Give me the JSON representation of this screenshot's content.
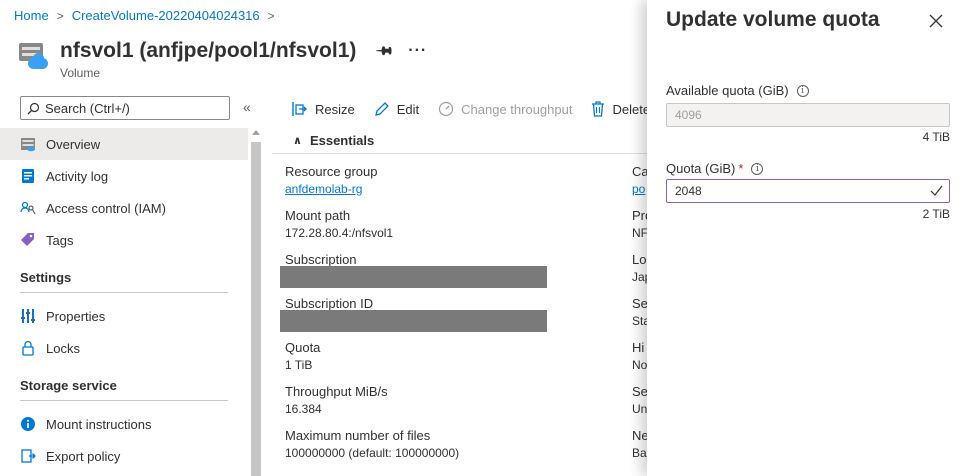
{
  "breadcrumb": {
    "items": [
      "Home",
      "CreateVolume-20220404024316"
    ]
  },
  "header": {
    "title": "nfsvol1 (anfjpe/pool1/nfsvol1)",
    "subtitle": "Volume"
  },
  "sidebar": {
    "search_placeholder": "Search (Ctrl+/)",
    "items": [
      {
        "label": "Overview",
        "icon": "overview-icon",
        "active": true
      },
      {
        "label": "Activity log",
        "icon": "activity-log-icon"
      },
      {
        "label": "Access control (IAM)",
        "icon": "iam-icon"
      },
      {
        "label": "Tags",
        "icon": "tag-icon"
      }
    ],
    "sections": [
      {
        "title": "Settings",
        "items": [
          {
            "label": "Properties",
            "icon": "properties-icon"
          },
          {
            "label": "Locks",
            "icon": "lock-icon"
          }
        ]
      },
      {
        "title": "Storage service",
        "items": [
          {
            "label": "Mount instructions",
            "icon": "info-icon"
          },
          {
            "label": "Export policy",
            "icon": "export-policy-icon"
          }
        ]
      }
    ]
  },
  "toolbar": {
    "resize": "Resize",
    "edit": "Edit",
    "change_throughput": "Change throughput",
    "delete": "Delete"
  },
  "essentials": {
    "heading": "Essentials",
    "left": [
      {
        "label": "Resource group",
        "value": "anfdemolab-rg",
        "link": true
      },
      {
        "label": "Mount path",
        "value": "172.28.80.4:/nfsvol1"
      },
      {
        "label": "Subscription",
        "value": ""
      },
      {
        "label": "Subscription ID",
        "value": ""
      },
      {
        "label": "Quota",
        "value": "1 TiB"
      },
      {
        "label": "Throughput MiB/s",
        "value": "16.384"
      },
      {
        "label": "Maximum number of files",
        "value": "100000000 (default: 100000000)"
      }
    ],
    "right": [
      {
        "label": "Ca",
        "value": "po",
        "link": true
      },
      {
        "label": "Pro",
        "value": "NF"
      },
      {
        "label": "Lo",
        "value": "Jap"
      },
      {
        "label": "Se",
        "value": "Sta"
      },
      {
        "label": "Hi",
        "value": "No"
      },
      {
        "label": "Se",
        "value": "Un"
      },
      {
        "label": "Ne",
        "value": "Ba"
      }
    ]
  },
  "panel": {
    "title": "Update volume quota",
    "available_label": "Available quota (GiB)",
    "available_value": "4096",
    "available_hint": "4 TiB",
    "quota_label": "Quota (GiB)",
    "quota_required": "*",
    "quota_value": "2048",
    "quota_hint": "2 TiB"
  },
  "colors": {
    "link": "#0078d4",
    "focus_border": "#8661c5",
    "required": "#a4262c",
    "active_nav": "#edebe9"
  }
}
